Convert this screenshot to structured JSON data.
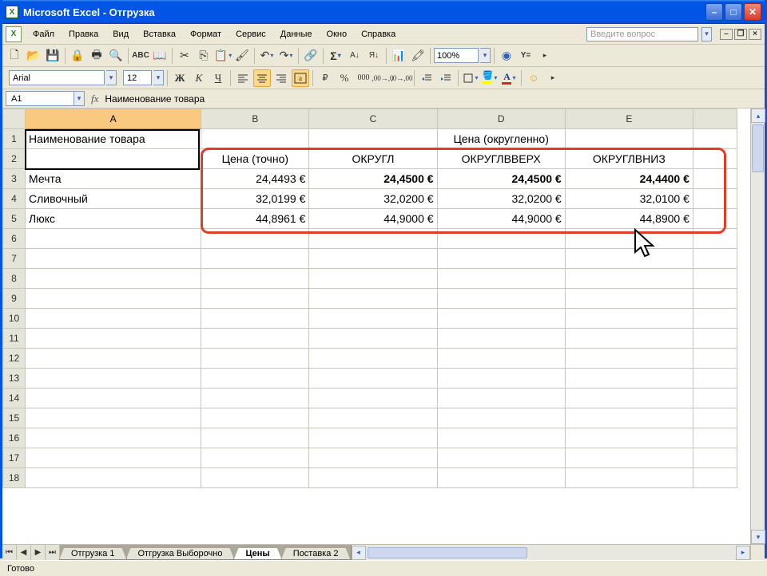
{
  "window": {
    "title": "Microsoft Excel - Отгрузка"
  },
  "menu": {
    "items": [
      "Файл",
      "Правка",
      "Вид",
      "Вставка",
      "Формат",
      "Сервис",
      "Данные",
      "Окно",
      "Справка"
    ],
    "ask_placeholder": "Введите вопрос"
  },
  "toolbar": {
    "zoom": "100%"
  },
  "format": {
    "font": "Arial",
    "size": "12"
  },
  "namebox": {
    "ref": "A1",
    "formula": "Наименование товара"
  },
  "columns": [
    "A",
    "B",
    "C",
    "D",
    "E"
  ],
  "data": {
    "r1": {
      "A": "Наименование товара",
      "B": "",
      "C": "",
      "D": "Цена (округленно)",
      "E": ""
    },
    "r2": {
      "A": "",
      "B": "Цена (точно)",
      "C": "ОКРУГЛ",
      "D": "ОКРУГЛВВЕРХ",
      "E": "ОКРУГЛВНИЗ"
    },
    "r3": {
      "A": "Мечта",
      "B": "24,4493 €",
      "C": "24,4500 €",
      "D": "24,4500 €",
      "E": "24,4400 €"
    },
    "r4": {
      "A": "Сливочный",
      "B": "32,0199 €",
      "C": "32,0200 €",
      "D": "32,0200 €",
      "E": "32,0100 €"
    },
    "r5": {
      "A": "Люкс",
      "B": "44,8961 €",
      "C": "44,9000 €",
      "D": "44,9000 €",
      "E": "44,8900 €"
    }
  },
  "tabs": {
    "items": [
      "Отгрузка 1",
      "Отгрузка Выборочно",
      "Цены",
      "Поставка 2"
    ],
    "active": "Цены"
  },
  "status": {
    "text": "Готово"
  },
  "chart_data": {
    "type": "table",
    "title": "Цена (округленно)",
    "columns": [
      "Наименование товара",
      "Цена (точно)",
      "ОКРУГЛ",
      "ОКРУГЛВВЕРХ",
      "ОКРУГЛВНИЗ"
    ],
    "rows": [
      {
        "Наименование товара": "Мечта",
        "Цена (точно)": "24,4493 €",
        "ОКРУГЛ": "24,4500 €",
        "ОКРУГЛВВЕРХ": "24,4500 €",
        "ОКРУГЛВНИЗ": "24,4400 €"
      },
      {
        "Наименование товара": "Сливочный",
        "Цена (точно)": "32,0199 €",
        "ОКРУГЛ": "32,0200 €",
        "ОКРУГЛВВЕРХ": "32,0200 €",
        "ОКРУГЛВНИЗ": "32,0100 €"
      },
      {
        "Наименование товара": "Люкс",
        "Цена (точно)": "44,8961 €",
        "ОКРУГЛ": "44,9000 €",
        "ОКРУГЛВВЕРХ": "44,9000 €",
        "ОКРУГЛВНИЗ": "44,8900 €"
      }
    ]
  }
}
